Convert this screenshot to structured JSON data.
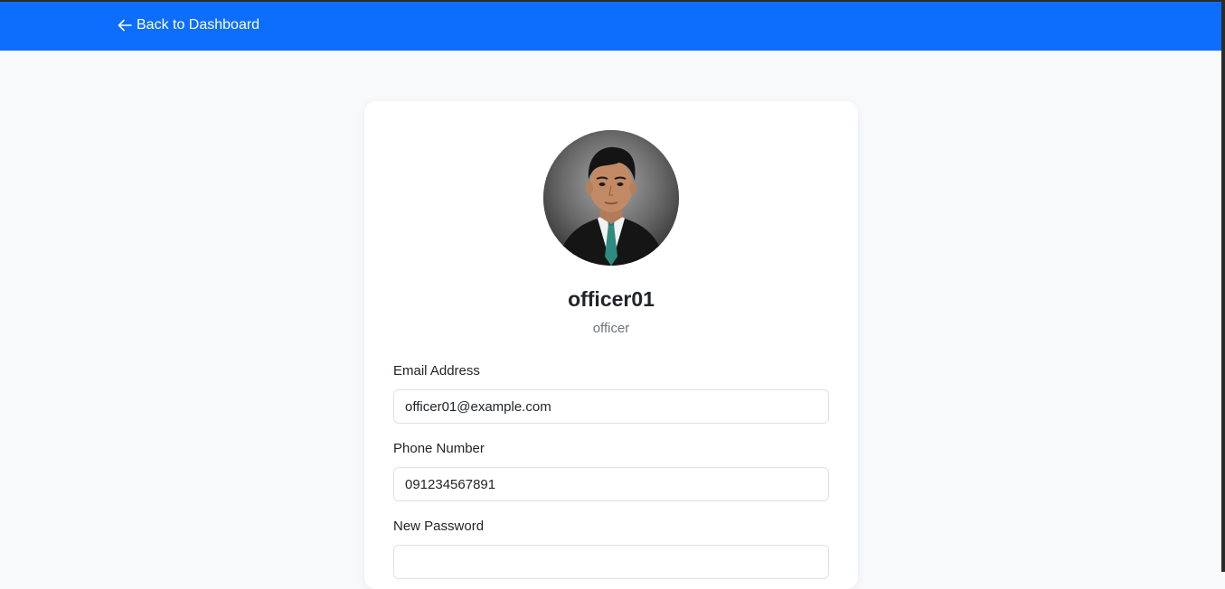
{
  "nav": {
    "back_label": "Back to Dashboard",
    "back_icon": "arrow-left-icon",
    "bar_color": "#0d6efd"
  },
  "profile": {
    "avatar": "profile-photo",
    "username": "officer01",
    "role": "officer"
  },
  "form": {
    "email": {
      "label": "Email Address",
      "value": "officer01@example.com"
    },
    "phone": {
      "label": "Phone Number",
      "value": "091234567891"
    },
    "new_password": {
      "label": "New Password",
      "value": ""
    }
  }
}
